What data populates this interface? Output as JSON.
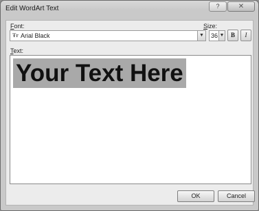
{
  "window": {
    "title": "Edit WordArt Text",
    "help_label": "?",
    "close_label": "✕"
  },
  "font": {
    "label": "Font:",
    "label_key": "F",
    "label_rest": "ont:",
    "value": "Arial Black",
    "type_glyph": "Ŧr"
  },
  "size": {
    "label_key": "S",
    "label_rest": "ize:",
    "value": "36"
  },
  "format": {
    "bold_label": "B",
    "italic_label": "I"
  },
  "text": {
    "label_key": "T",
    "label_rest": "ext:",
    "value": "Your Text Here"
  },
  "buttons": {
    "ok": "OK",
    "cancel": "Cancel"
  },
  "icons": {
    "dropdown": "chevron-down-icon"
  },
  "colors": {
    "selection": "#a9a9a9"
  }
}
